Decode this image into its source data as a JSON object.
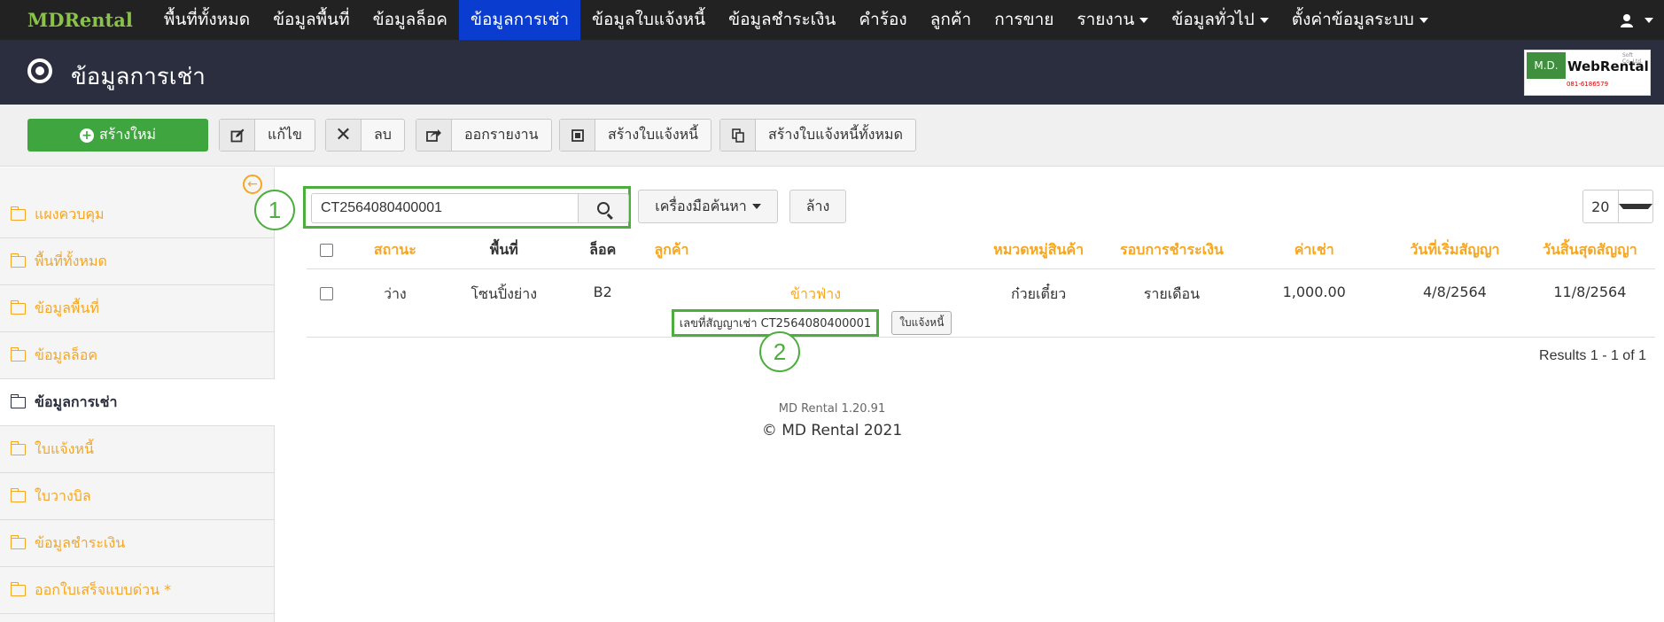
{
  "nav": {
    "brand": "MDRental",
    "items": [
      {
        "label": "พื้นที่ทั้งหมด",
        "dropdown": false,
        "active": false
      },
      {
        "label": "ข้อมูลพื้นที่",
        "dropdown": false,
        "active": false
      },
      {
        "label": "ข้อมูลล็อค",
        "dropdown": false,
        "active": false
      },
      {
        "label": "ข้อมูลการเช่า",
        "dropdown": false,
        "active": true
      },
      {
        "label": "ข้อมูลใบแจ้งหนี้",
        "dropdown": false,
        "active": false
      },
      {
        "label": "ข้อมูลชำระเงิน",
        "dropdown": false,
        "active": false
      },
      {
        "label": "คำร้อง",
        "dropdown": false,
        "active": false
      },
      {
        "label": "ลูกค้า",
        "dropdown": false,
        "active": false
      },
      {
        "label": "การขาย",
        "dropdown": false,
        "active": false
      },
      {
        "label": "รายงาน",
        "dropdown": true,
        "active": false
      },
      {
        "label": "ข้อมูลทั่วไป",
        "dropdown": true,
        "active": false
      },
      {
        "label": "ตั้งค่าข้อมูลระบบ",
        "dropdown": true,
        "active": false
      }
    ],
    "user_icon": "user-icon"
  },
  "header": {
    "title": "ข้อมูลการเช่า",
    "logo": {
      "left": "M.D.",
      "right": "WebRental",
      "sub": "Soft Co.,Ltd.",
      "phone": "081-6186579"
    }
  },
  "toolbar": {
    "new_label": "สร้างใหม่",
    "edit_label": "แก้ไข",
    "delete_label": "ลบ",
    "export_label": "ออกรายงาน",
    "create_invoice_label": "สร้างใบแจ้งหนี้",
    "create_all_invoices_label": "สร้างใบแจ้งหนี้ทั้งหมด"
  },
  "sidebar": {
    "items": [
      {
        "label": "แผงควบคุม",
        "active": false
      },
      {
        "label": "พื้นที่ทั้งหมด",
        "active": false
      },
      {
        "label": "ข้อมูลพื้นที่",
        "active": false
      },
      {
        "label": "ข้อมูลล็อค",
        "active": false
      },
      {
        "label": "ข้อมูลการเช่า",
        "active": true
      },
      {
        "label": "ใบแจ้งหนี้",
        "active": false
      },
      {
        "label": "ใบวางบิล",
        "active": false
      },
      {
        "label": "ข้อมูลชำระเงิน",
        "active": false
      },
      {
        "label": "ออกใบเสร็จแบบด่วน *",
        "active": false
      }
    ]
  },
  "search": {
    "value": "CT2564080400001",
    "tools_label": "เครื่องมือค้นหา",
    "clear_label": "ล้าง",
    "page_size": "20"
  },
  "callouts": {
    "one": "1",
    "two": "2"
  },
  "table": {
    "headers": [
      "สถานะ",
      "พื้นที่",
      "ล็อค",
      "ลูกค้า",
      "หมวดหมู่สินค้า",
      "รอบการชำระเงิน",
      "ค่าเช่า",
      "วันที่เริ่มสัญญา",
      "วันสิ้นสุดสัญญา"
    ],
    "rows": [
      {
        "status": "ว่าง",
        "area": "โซนปิ้งย่าง",
        "lock": "B2",
        "customer": "ข้าวฟ่าง",
        "contract": "เลขที่สัญญาเช่า CT2564080400001",
        "invoice_btn": "ใบแจ้งหนี้",
        "category": "ก๋วยเตี๋ยว",
        "cycle": "รายเดือน",
        "rent": "1,000.00",
        "start": "4/8/2564",
        "end": "11/8/2564"
      }
    ]
  },
  "results": "Results 1 - 1 of 1",
  "footer": {
    "version": "MD Rental 1.20.91",
    "copyright": "© MD Rental 2021"
  }
}
